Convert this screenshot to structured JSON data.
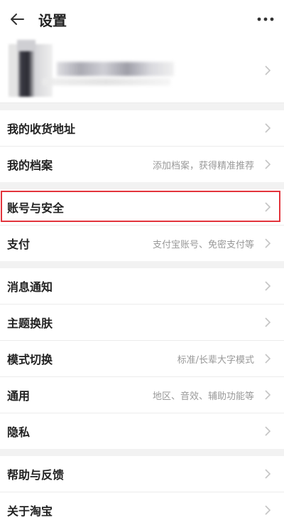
{
  "header": {
    "title": "设置",
    "back_icon": "arrow-left-icon",
    "more_icon": "more-dots-icon"
  },
  "groups": [
    {
      "rows": [
        {
          "label": "我的收货地址",
          "desc": ""
        },
        {
          "label": "我的档案",
          "desc": "添加档案，获得精准推荐"
        }
      ]
    },
    {
      "rows": [
        {
          "label": "账号与安全",
          "desc": "",
          "highlighted": true
        },
        {
          "label": "支付",
          "desc": "支付宝账号、免密支付等"
        }
      ]
    },
    {
      "rows": [
        {
          "label": "消息通知",
          "desc": ""
        },
        {
          "label": "主题换肤",
          "desc": ""
        },
        {
          "label": "模式切换",
          "desc": "标准/长辈大字模式"
        },
        {
          "label": "通用",
          "desc": "地区、音效、辅助功能等"
        },
        {
          "label": "隐私",
          "desc": ""
        }
      ]
    },
    {
      "rows": [
        {
          "label": "帮助与反馈",
          "desc": ""
        },
        {
          "label": "关于淘宝",
          "desc": ""
        }
      ]
    }
  ],
  "colors": {
    "highlight": "#e3343c",
    "desc": "#999999",
    "chevron": "#c4c4c4"
  }
}
